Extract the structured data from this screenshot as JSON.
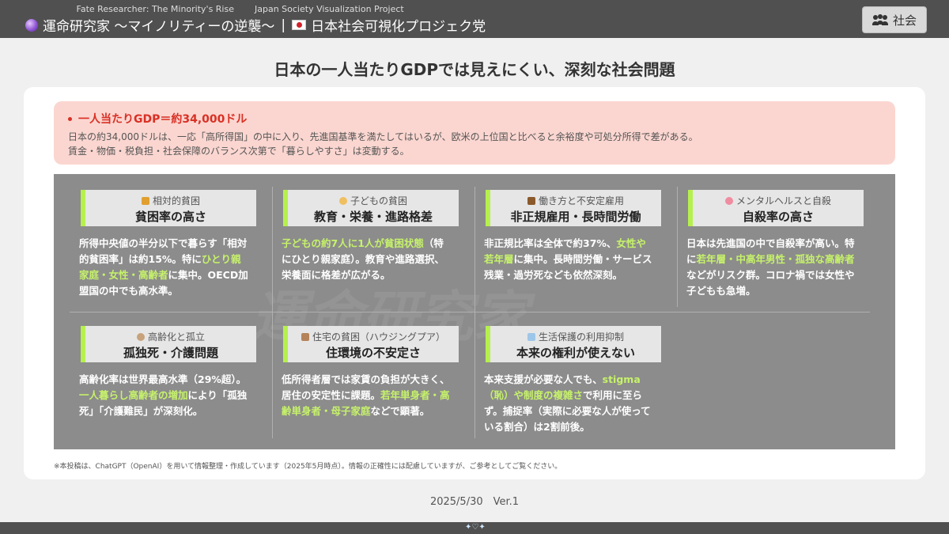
{
  "header": {
    "sub1": "Fate Researcher: The Minority's Rise",
    "sub2": "Japan Society Visualization Project",
    "title1": "運命研究家 〜マイノリティーの逆襲〜",
    "separator": "|",
    "title2": "日本社会可視化プロジェク党",
    "button_label": "社会"
  },
  "title": "日本の一人当たりGDPでは見えにくい、深刻な社会問題",
  "highlight": {
    "heading": "一人当たりGDP＝約34,000ドル",
    "line1": "日本の約34,000ドルは、一応「高所得国」の中に入り、先進国基準を満たしてはいるが、欧米の上位国と比べると余裕度や可処分所得で差がある。",
    "line2": "賃金・物価・税負担・社会保障のバランス次第で「暮らしやすさ」は変動する。"
  },
  "issues": [
    {
      "sub": "相対的貧困",
      "main": "貧困率の高さ",
      "icon": "people-icon",
      "d": [
        "所得中央値の半分以下で暮らす「相対的貧困率」は約15%。特に",
        "ひとり親家庭・女性・高齢者",
        "に集中。OECD加盟国の中でも高水準。"
      ]
    },
    {
      "sub": "子どもの貧困",
      "main": "教育・栄養・進路格差",
      "icon": "child-icon",
      "d": [
        "",
        "子どもの約7人に1人が貧困状態",
        "（特にひとり親家庭）。教育や進路選択、栄養面に格差が広がる。"
      ]
    },
    {
      "sub": "働き方と不安定雇用",
      "main": "非正規雇用・長時間労働",
      "icon": "briefcase-icon",
      "d": [
        "非正規比率は全体で約37%、",
        "女性や若年層",
        "に集中。長時間労働・サービス残業・過労死なども依然深刻。"
      ]
    },
    {
      "sub": "メンタルヘルスと自殺",
      "main": "自殺率の高さ",
      "icon": "brain-icon",
      "d": [
        "日本は先進国の中で自殺率が高い。特に",
        "若年層・中高年男性・孤独な高齢者",
        "などがリスク群。コロナ禍では女性や子どもも急増。"
      ]
    },
    {
      "sub": "高齢化と孤立",
      "main": "孤独死・介護問題",
      "icon": "elder-icon",
      "d": [
        "高齢化率は世界最高水準（29%超）。",
        "一人暮らし高齢者の増加",
        "により「孤独死」「介護難民」が深刻化。"
      ]
    },
    {
      "sub": "住宅の貧困（ハウジングプア）",
      "main": "住環境の不安定さ",
      "icon": "house-icon",
      "d": [
        "低所得者層では家賃の負担が大きく、居住の安定性に課題。",
        "若年単身者・高齢単身者・母子家庭",
        "などで顕著。"
      ]
    },
    {
      "sub": "生活保護の利用抑制",
      "main": "本来の権利が使えない",
      "icon": "document-icon",
      "d": [
        "本来支援が必要な人でも、",
        "stigma（恥）や制度の複雑さ",
        "で利用に至らず。捕捉率（実際に必要な人が使っている割合）は2割前後。"
      ]
    }
  ],
  "footnote": "※本投稿は、ChatGPT（OpenAI）を用いて情報整理・作成しています（2025年5月時点）。情報の正確性には配慮していますが、ご参考としてご覧ください。",
  "date": "2025/5/30　Ver.1",
  "watermark": "運命研究家",
  "colors": {
    "accent": "#b6f04d",
    "highlight_bg": "#fbd6d0",
    "heading_red": "#d93025",
    "panel": "#8c8c8c"
  }
}
